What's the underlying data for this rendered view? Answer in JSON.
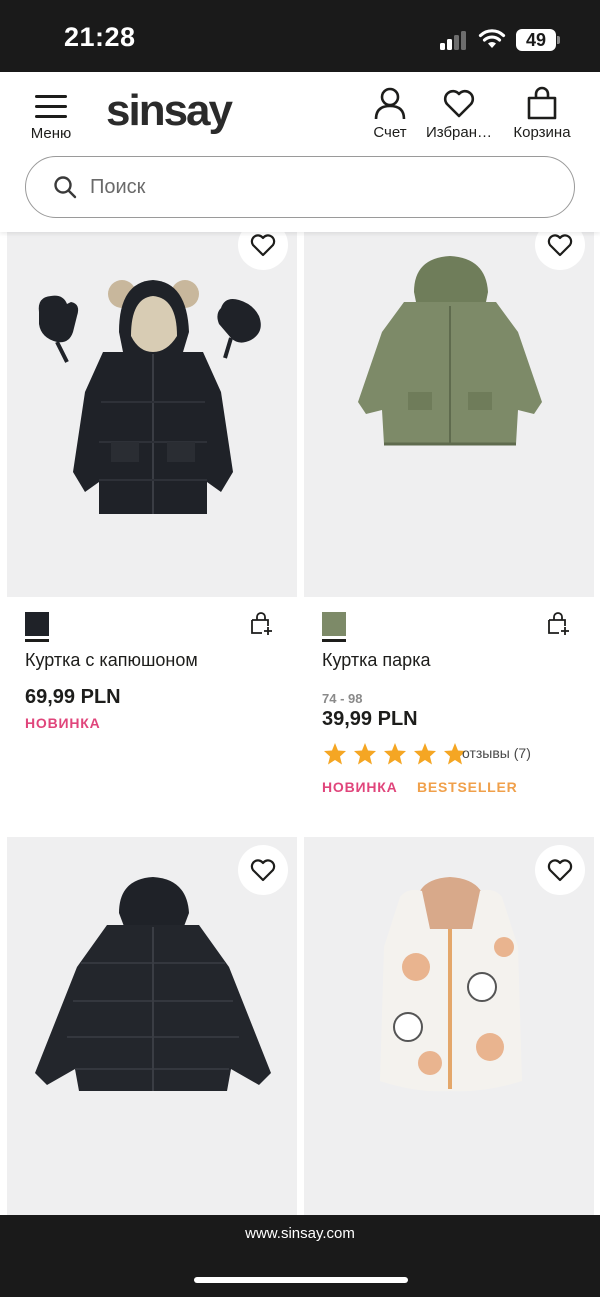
{
  "status_bar": {
    "time": "21:28",
    "battery": "49"
  },
  "header": {
    "menu_label": "Меню",
    "logo": "sinsay",
    "account_label": "Счет",
    "favorites_label": "Избран…",
    "cart_label": "Корзина"
  },
  "search": {
    "placeholder": "Поиск",
    "value": ""
  },
  "products": [
    {
      "name": "Куртка с капюшоном",
      "price": "69,99 PLN",
      "badge": "НОВИНКА",
      "swatch_color": "#1f2228",
      "image_icon": "black-puffer-jacket-with-mittens"
    },
    {
      "name": "Куртка парка",
      "sizes": "74 - 98",
      "price": "39,99 PLN",
      "rating_stars": 5,
      "reviews": "отзывы (7)",
      "badge": "НОВИНКА",
      "badge2": "BESTSELLER",
      "swatch_color": "#7d8a68",
      "image_icon": "green-parka"
    },
    {
      "image_icon": "black-puffer-jacket"
    },
    {
      "image_icon": "printed-vest"
    }
  ],
  "colors": {
    "badge_new": "#e0457b",
    "badge_bestseller": "#f0a04b",
    "star": "#f5a623"
  },
  "browser": {
    "url": "www.sinsay.com"
  }
}
